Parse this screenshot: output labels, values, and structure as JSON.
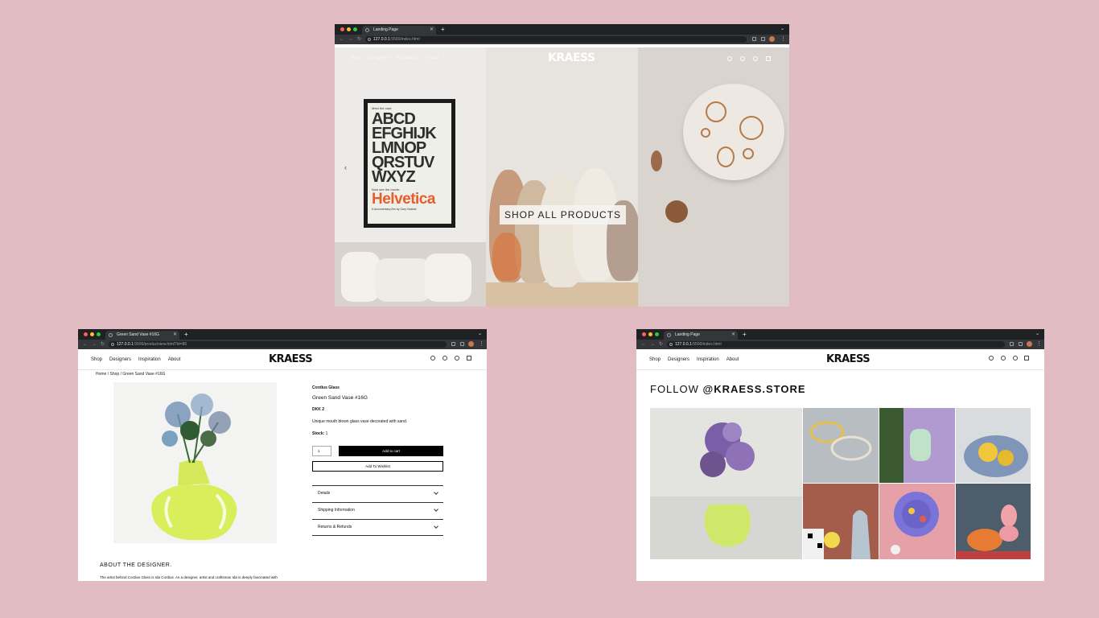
{
  "colors": {
    "background": "#e2bcc3",
    "browser_chrome": "#202124",
    "toolbar": "#35363a",
    "accent_orange": "#e85b2a"
  },
  "hero_window": {
    "tab_title": "Landing Page",
    "url_host": "127.0.0.1",
    "url_path": ":5500/index.html",
    "nav": [
      "Shop",
      "Designers",
      "Inspiration",
      "About"
    ],
    "logo": "KRAESS",
    "poster": {
      "top_line": "Meet the cast:",
      "letters": [
        "ABCD",
        "EFGHIJK",
        "LMNOP",
        "QRSTUV",
        "WXYZ"
      ],
      "sub": "Now see the movie:",
      "title": "Helvetica",
      "foot": "A documentary film by Gary Hustwit"
    },
    "cta": "SHOP ALL PRODUCTS",
    "icons": [
      "user-icon",
      "search-icon",
      "heart-icon",
      "bag-icon"
    ]
  },
  "product_window": {
    "tab_title": "Green Sand Vase #16G",
    "url_host": "127.0.0.1",
    "url_path": ":5500/productview.html?id=86",
    "nav": [
      "Shop",
      "Designers",
      "Inspiration",
      "About"
    ],
    "logo": "KRAESS",
    "breadcrumb": [
      "Home",
      "/",
      "Shop",
      "/",
      "Green Sand Vase #16G"
    ],
    "product": {
      "brand": "Cordius Glass",
      "name": "Green Sand Vase #16G",
      "price": "DKK 2",
      "description": "Unique mouth blown glass vase decorated with sand.",
      "stock_label": "Stock:",
      "stock_value": "1",
      "quantity": "1",
      "add_to_cart": "Add to cart",
      "add_to_wishlist": "Add To Wishlist",
      "accordions": [
        "Details",
        "Shipping Information",
        "Returns & Refunds"
      ]
    },
    "about_heading": "ABOUT THE DESIGNER.",
    "about_text": "The artist behind Cordius Glass is Ida Cordius. As a designer, artist and craftsman Ida is deeply fascinated with"
  },
  "follow_window": {
    "tab_title": "Landing Page",
    "url_host": "127.0.0.1",
    "url_path": ":5500/index.html",
    "nav": [
      "Shop",
      "Designers",
      "Inspiration",
      "About"
    ],
    "logo": "KRAESS",
    "follow_prefix": "FOLLOW",
    "follow_handle": "@KRAESS.STORE"
  }
}
